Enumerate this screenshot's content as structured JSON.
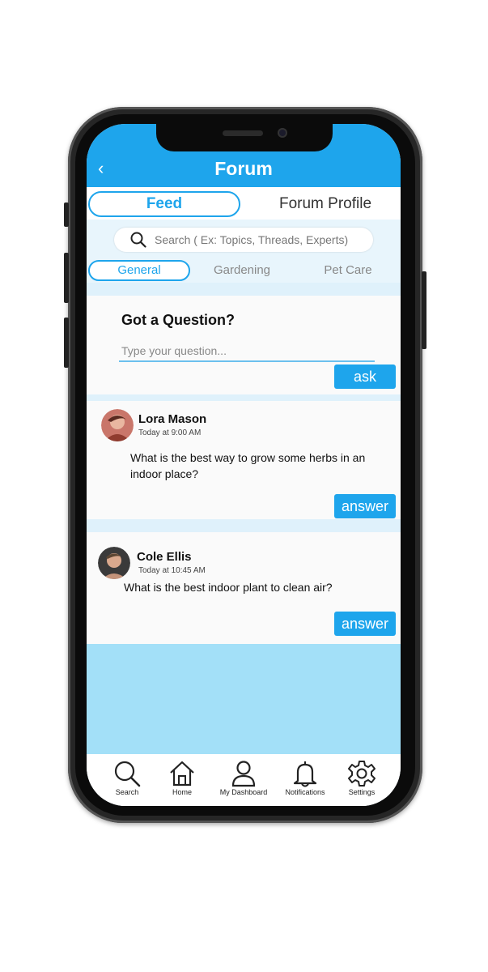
{
  "header": {
    "title": "Forum",
    "back_icon": "chevron-left-icon"
  },
  "top_tabs": [
    {
      "label": "Feed",
      "active": true
    },
    {
      "label": "Forum Profile",
      "active": false
    }
  ],
  "search": {
    "placeholder": "Search ( Ex: Topics, Threads, Experts)",
    "icon": "search-icon"
  },
  "categories": [
    {
      "label": "General",
      "active": true
    },
    {
      "label": "Gardening",
      "active": false
    },
    {
      "label": "Pet Care",
      "active": false
    }
  ],
  "ask": {
    "title": "Got a Question?",
    "placeholder": "Type your question...",
    "button_label": "ask"
  },
  "posts": [
    {
      "name": "Lora Mason",
      "time": "Today at 9:00 AM",
      "question": "What is the best way to grow some herbs in an indoor place?",
      "button_label": "answer"
    },
    {
      "name": "Cole Ellis",
      "time": "Today at 10:45 AM",
      "question": "What is the best indoor plant to clean air?",
      "button_label": "answer"
    }
  ],
  "nav": [
    {
      "label": "Search",
      "icon": "search-icon"
    },
    {
      "label": "Home",
      "icon": "home-icon"
    },
    {
      "label": "My Dashboard",
      "icon": "user-icon"
    },
    {
      "label": "Notifications",
      "icon": "bell-icon"
    },
    {
      "label": "Settings",
      "icon": "gear-icon"
    }
  ],
  "colors": {
    "accent": "#1ea5ec",
    "light_bg": "#e8f5fc",
    "fill": "#a3e0f8"
  }
}
